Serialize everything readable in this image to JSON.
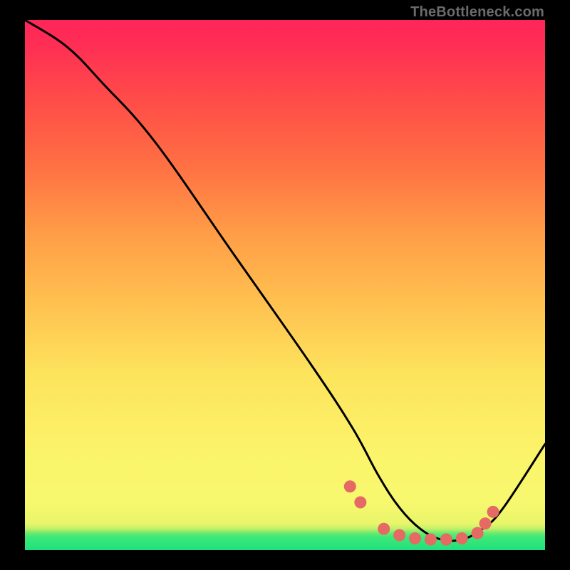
{
  "watermark": "TheBottleneck.com",
  "chart_data": {
    "type": "line",
    "title": "",
    "xlabel": "",
    "ylabel": "",
    "xlim": [
      0,
      100
    ],
    "ylim": [
      0,
      100
    ],
    "series": [
      {
        "name": "bottleneck-curve",
        "x": [
          0,
          8,
          15,
          25,
          40,
          55,
          63,
          68,
          72,
          76,
          80,
          84,
          88,
          92,
          100
        ],
        "y": [
          100,
          95,
          88,
          77,
          56,
          35,
          23,
          14,
          8,
          4,
          2,
          2,
          4,
          8,
          20
        ]
      }
    ],
    "markers": {
      "name": "dots",
      "x": [
        62.5,
        64.5,
        69.0,
        72.0,
        75.0,
        78.0,
        81.0,
        84.0,
        87.0,
        88.5,
        90.0
      ],
      "y": [
        12.0,
        9.0,
        4.0,
        2.8,
        2.2,
        2.0,
        2.0,
        2.2,
        3.2,
        5.0,
        7.2
      ]
    },
    "colors": {
      "curve": "#000000",
      "marker": "#e46a63"
    }
  }
}
